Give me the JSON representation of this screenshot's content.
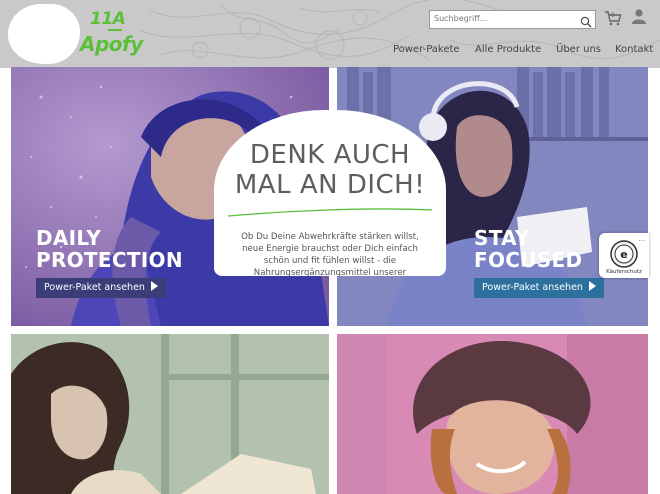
{
  "logo": {
    "line1": "11A",
    "line2": "Apofy"
  },
  "search": {
    "placeholder": "Suchbegriff..."
  },
  "cart": {
    "count": "0"
  },
  "nav": {
    "items": [
      {
        "label": "Power-Pakete"
      },
      {
        "label": "Alle Produkte"
      },
      {
        "label": "Über uns"
      },
      {
        "label": "Kontakt"
      }
    ]
  },
  "tiles": [
    {
      "title_line1": "DAILY",
      "title_line2": "PROTECTION",
      "button": "Power-Paket ansehen"
    },
    {
      "title_line1": "STAY",
      "title_line2": "FOCUSED",
      "button": "Power-Paket ansehen"
    }
  ],
  "bubble": {
    "title_line1": "DENK AUCH",
    "title_line2": "MAL AN DICH!",
    "text_line1": "Ob Du Deine Abwehrkräfte stärken willst,",
    "text_line2": "neue Energie brauchst oder Dich einfach",
    "text_line3": "schön und fit fühlen willst - die",
    "text_line4": "Nahrungsergänzungsmittel unserer"
  },
  "trust_badge": {
    "label": "Käuferschutz",
    "menu": "..."
  },
  "colors": {
    "brand_green": "#5cbf3a",
    "header_gray": "#c9c9c9",
    "tile1_button": "#3a3d78",
    "tile2_button": "#2d6f9d"
  }
}
